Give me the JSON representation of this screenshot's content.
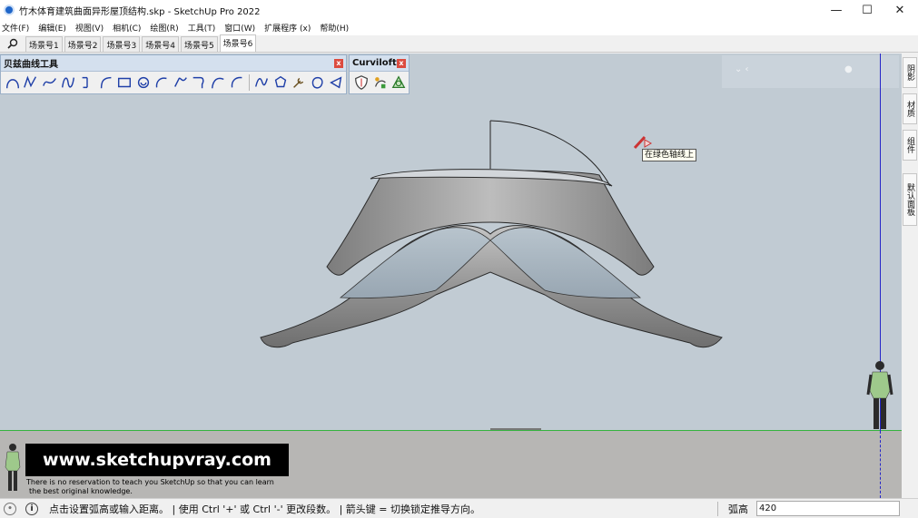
{
  "window": {
    "title": "竹木体育建筑曲面异形屋顶结构.skp - SketchUp Pro 2022",
    "minimize": "—",
    "maximize": "☐",
    "close": "✕"
  },
  "menu": [
    {
      "label": "文件(F)"
    },
    {
      "label": "编辑(E)"
    },
    {
      "label": "视图(V)"
    },
    {
      "label": "相机(C)"
    },
    {
      "label": "绘图(R)"
    },
    {
      "label": "工具(T)"
    },
    {
      "label": "窗口(W)"
    },
    {
      "label": "扩展程序 (x)"
    },
    {
      "label": "帮助(H)"
    }
  ],
  "scenes": [
    {
      "label": "场景号1"
    },
    {
      "label": "场景号2"
    },
    {
      "label": "场景号3"
    },
    {
      "label": "场景号4"
    },
    {
      "label": "场景号5"
    },
    {
      "label": "场景号6"
    }
  ],
  "active_scene": "场景号6",
  "toolbars": {
    "bezier": {
      "title": "贝兹曲线工具",
      "close": "x",
      "icon_names": [
        "arc-curve-icon",
        "polyline-curve-icon",
        "freehand-curve-icon",
        "bspline-curve-icon",
        "divide-curve-icon",
        "circle-arc-icon",
        "rectangle-icon",
        "spiral-icon",
        "arc-3pt-icon",
        "catmull-icon",
        "fillet-icon",
        "arc-rounded-icon",
        "arc-open-icon",
        "nurbs-curve-icon",
        "polygon-icon",
        "wrench-icon",
        "ellipse-icon",
        "triangle-icon"
      ],
      "icon_color": "#2040a8"
    },
    "curviloft": {
      "title": "Curviloft",
      "close": "x",
      "icon_names": [
        "loft-shield-icon",
        "skin-contour-icon",
        "loft-path-icon"
      ]
    }
  },
  "tray_tabs": [
    {
      "label": "阴影"
    },
    {
      "label": "材质"
    },
    {
      "label": "组件"
    },
    {
      "label": "默认面板"
    }
  ],
  "tooltip": "在绿色轴线上",
  "watermark": {
    "site": "www.sketchupvray.com",
    "line1": "There is no reservation to teach you SketchUp so that you can learn",
    "line2": "the best original knowledge."
  },
  "status": {
    "message": "点击设置弧高或输入距离。 | 使用 Ctrl '+' 或 Ctrl '-' 更改段数。 | 箭头键 = 切换锁定推导方向。",
    "measure_label": "弧高",
    "measure_value": "420"
  },
  "colors": {
    "viewport_bg": "#c1cbd3",
    "ground": "#b7b6b4",
    "green_axis": "#35b33f",
    "blue_axis": "#2525c8",
    "roof_gray": "#8e8e8e",
    "roof_blue": "#aebdc9"
  }
}
